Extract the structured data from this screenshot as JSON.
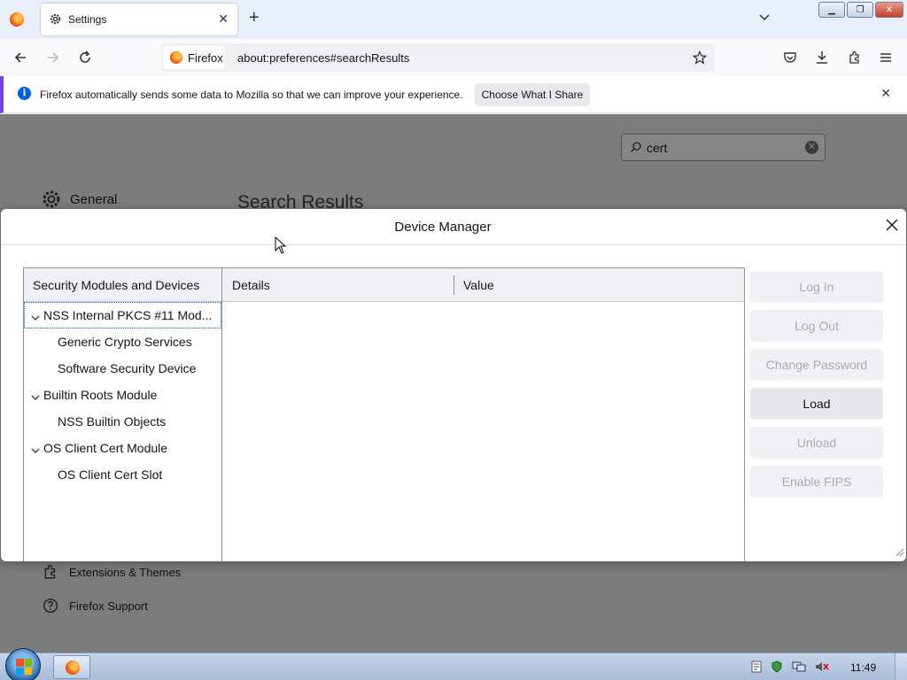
{
  "browser": {
    "tab": {
      "title": "Settings"
    },
    "identity_label": "Firefox",
    "url": "about:preferences#searchResults"
  },
  "notification": {
    "message": "Firefox automatically sends some data to Mozilla so that we can improve your experience.",
    "button": "Choose What I Share"
  },
  "prefs": {
    "search_value": "cert",
    "category_general": "General",
    "heading": "Search Results",
    "extensions": "Extensions & Themes",
    "support": "Firefox Support"
  },
  "dialog": {
    "title": "Device Manager",
    "tree_header": "Security Modules and Devices",
    "tree": [
      {
        "label": "NSS Internal PKCS #11 Mod...",
        "level": 0,
        "expanded": true,
        "selected": true
      },
      {
        "label": "Generic Crypto Services",
        "level": 1
      },
      {
        "label": "Software Security Device",
        "level": 1
      },
      {
        "label": "Builtin Roots Module",
        "level": 0,
        "expanded": true
      },
      {
        "label": "NSS Builtin Objects",
        "level": 1
      },
      {
        "label": "OS Client Cert Module",
        "level": 0,
        "expanded": true
      },
      {
        "label": "OS Client Cert Slot",
        "level": 1
      }
    ],
    "columns": {
      "details": "Details",
      "value": "Value"
    },
    "buttons": {
      "log_in": "Log In",
      "log_out": "Log Out",
      "change_password": "Change Password",
      "load": "Load",
      "unload": "Unload",
      "enable_fips": "Enable FIPS"
    }
  },
  "taskbar": {
    "clock": "11:49"
  },
  "colors": {
    "accent": "#7542e5",
    "info": "#0060df",
    "dim_overlay": "#7c7c7c"
  }
}
